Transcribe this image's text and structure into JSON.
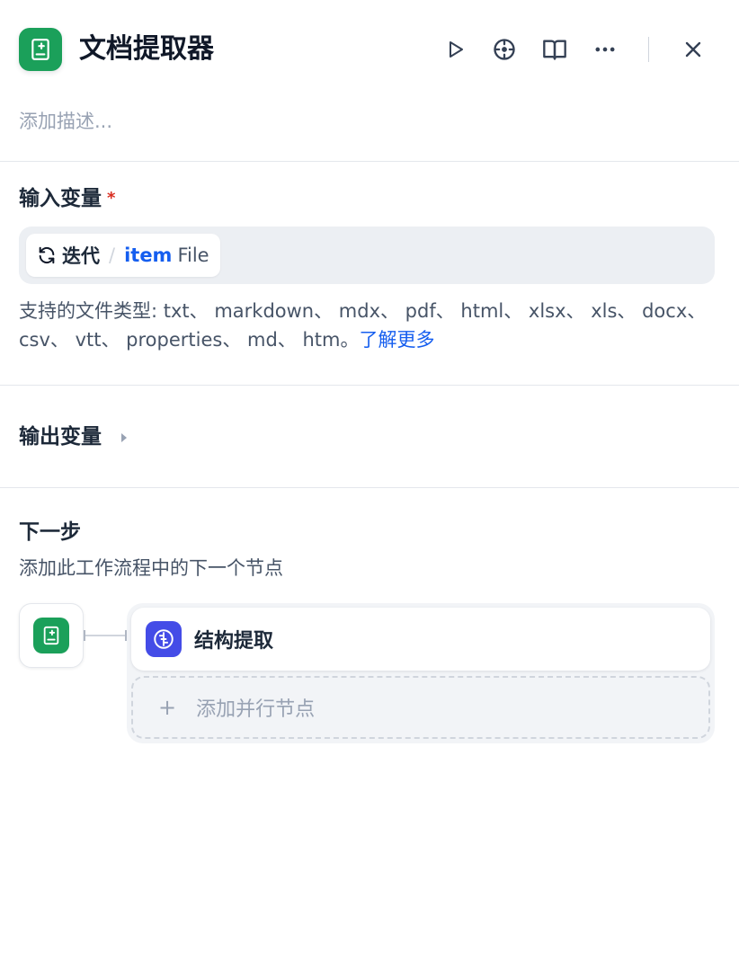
{
  "header": {
    "app_icon": "document-extractor-icon",
    "title": "文档提取器",
    "actions": [
      "run-icon",
      "target-icon",
      "book-icon",
      "more-icon",
      "close-icon"
    ],
    "description_placeholder": "添加描述..."
  },
  "input_section": {
    "title": "输入变量",
    "required_mark": "*",
    "variable": {
      "icon": "loop-icon",
      "node": "迭代",
      "separator": "/",
      "name": "item",
      "type": "File"
    },
    "supported_text": "支持的文件类型: txt、 markdown、 mdx、 pdf、 html、 xlsx、 xls、 docx、 csv、 vtt、 properties、 md、 htm。",
    "learn_more": "了解更多"
  },
  "output_section": {
    "title": "输出变量",
    "expand_icon": "caret-right-icon"
  },
  "next_step": {
    "title": "下一步",
    "description": "添加此工作流程中的下一个节点",
    "target_node": {
      "icon": "llm-structure-icon",
      "label": "结构提取"
    },
    "add_parallel_label": "添加并行节点"
  },
  "colors": {
    "brand_green": "#1ba05a",
    "link_blue": "#155eef",
    "node_indigo": "#444ce7",
    "required_red": "#d92d20"
  }
}
